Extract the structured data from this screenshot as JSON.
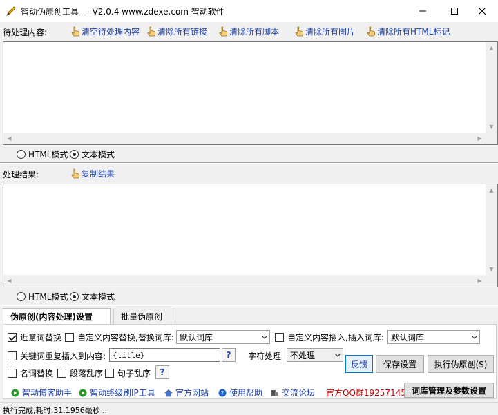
{
  "window": {
    "title": "智动伪原创工具",
    "version_site": "- V2.0.4  www.zdexe.com 智动软件"
  },
  "input_section": {
    "label": "待处理内容:",
    "actions": [
      "清空待处理内容",
      "清除所有链接",
      "清除所有脚本",
      "清除所有图片",
      "清除所有HTML标记"
    ],
    "text": ""
  },
  "input_modes": {
    "html": "HTML模式",
    "text": "文本模式",
    "selected": "text"
  },
  "result_section": {
    "label": "处理结果:",
    "actions": [
      "复制结果"
    ],
    "text": ""
  },
  "result_modes": {
    "html": "HTML模式",
    "text": "文本模式",
    "selected": "text"
  },
  "tabs": [
    "伪原创(内容处理)设置",
    "批量伪原创"
  ],
  "settings": {
    "synonym_replace": {
      "label": "近意词替换",
      "checked": true
    },
    "custom_replace": {
      "label": "自定义内容替换,替换词库:",
      "checked": false,
      "library": "默认词库"
    },
    "custom_insert": {
      "label": "自定义内容插入,插入词库:",
      "checked": false,
      "library": "默认词库"
    },
    "keyword_insert": {
      "label": "关键词重复插入到内容:",
      "checked": false,
      "value": "{title}"
    },
    "char_process": {
      "label": "字符处理",
      "value": "不处理"
    },
    "noun_replace": {
      "label": "名词替换",
      "checked": false
    },
    "paragraph_shuffle": {
      "label": "段落乱序",
      "checked": false
    },
    "sentence_shuffle": {
      "label": "句子乱序",
      "checked": false
    },
    "help": "?"
  },
  "buttons": {
    "feedback": "反馈",
    "save": "保存设置",
    "execute": "执行伪原创(S)",
    "library_manage": "词库管理及参数设置"
  },
  "bottom_links": [
    "智动博客助手",
    "智动终级刷IP工具",
    "官方网站",
    "使用帮助",
    "交流论坛"
  ],
  "qq_group": "官方QQ群19257145",
  "status": "执行完成,耗时:31.1956毫秒  ..",
  "colors": {
    "link": "#1c3fa8",
    "qq": "#d00000",
    "accent": "#0078d7"
  }
}
